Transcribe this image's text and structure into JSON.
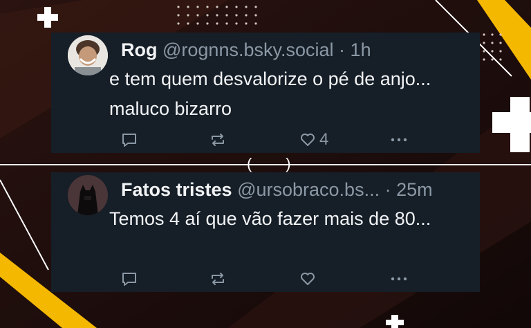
{
  "posts": [
    {
      "name": "Rog",
      "handle": "@rognns.bsky.social",
      "time": "1h",
      "text": "e tem quem desvalorize o pé de anjo... maluco bizarro",
      "like_count": "4"
    },
    {
      "name": "Fatos tristes",
      "handle": "@ursobraco.bs...",
      "time": "25m",
      "text": "Temos 4 aí que vão fazer mais de 80..."
    }
  ],
  "header_separator": "·",
  "divider_marks": "(        )",
  "icons": {
    "reply": "comment-bubble-icon",
    "repost": "repost-arrows-icon",
    "like": "heart-icon",
    "more": "ellipsis-icon"
  },
  "colors": {
    "background": "#1a0d0c",
    "card": "#161e27",
    "text": "#f1f3f5",
    "muted": "#8b98a5",
    "accent": "#f5b800"
  }
}
